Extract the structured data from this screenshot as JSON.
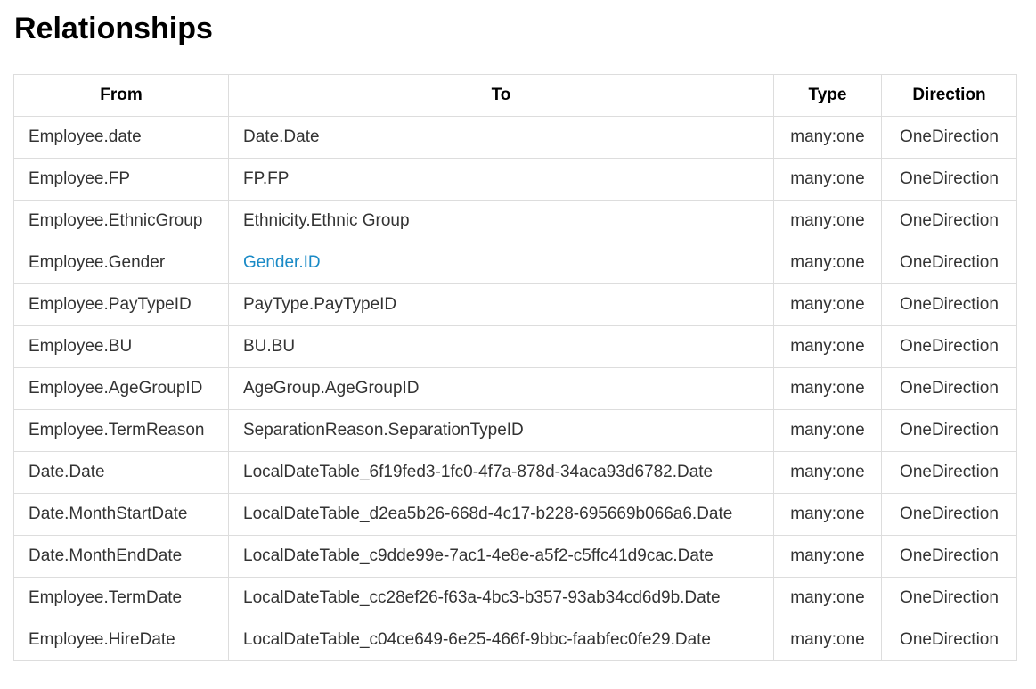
{
  "page": {
    "title": "Relationships"
  },
  "table": {
    "headers": [
      "From",
      "To",
      "Type",
      "Direction"
    ],
    "rows": [
      {
        "from": "Employee.date",
        "to": "Date.Date",
        "type": "many:one",
        "direction": "OneDirection",
        "to_is_link": false
      },
      {
        "from": "Employee.FP",
        "to": "FP.FP",
        "type": "many:one",
        "direction": "OneDirection",
        "to_is_link": false
      },
      {
        "from": "Employee.EthnicGroup",
        "to": "Ethnicity.Ethnic Group",
        "type": "many:one",
        "direction": "OneDirection",
        "to_is_link": false
      },
      {
        "from": "Employee.Gender",
        "to": "Gender.ID",
        "type": "many:one",
        "direction": "OneDirection",
        "to_is_link": true
      },
      {
        "from": "Employee.PayTypeID",
        "to": "PayType.PayTypeID",
        "type": "many:one",
        "direction": "OneDirection",
        "to_is_link": false
      },
      {
        "from": "Employee.BU",
        "to": "BU.BU",
        "type": "many:one",
        "direction": "OneDirection",
        "to_is_link": false
      },
      {
        "from": "Employee.AgeGroupID",
        "to": "AgeGroup.AgeGroupID",
        "type": "many:one",
        "direction": "OneDirection",
        "to_is_link": false
      },
      {
        "from": "Employee.TermReason",
        "to": "SeparationReason.SeparationTypeID",
        "type": "many:one",
        "direction": "OneDirection",
        "to_is_link": false
      },
      {
        "from": "Date.Date",
        "to": "LocalDateTable_6f19fed3-1fc0-4f7a-878d-34aca93d6782.Date",
        "type": "many:one",
        "direction": "OneDirection",
        "to_is_link": false
      },
      {
        "from": "Date.MonthStartDate",
        "to": "LocalDateTable_d2ea5b26-668d-4c17-b228-695669b066a6.Date",
        "type": "many:one",
        "direction": "OneDirection",
        "to_is_link": false
      },
      {
        "from": "Date.MonthEndDate",
        "to": "LocalDateTable_c9dde99e-7ac1-4e8e-a5f2-c5ffc41d9cac.Date",
        "type": "many:one",
        "direction": "OneDirection",
        "to_is_link": false
      },
      {
        "from": "Employee.TermDate",
        "to": "LocalDateTable_cc28ef26-f63a-4bc3-b357-93ab34cd6d9b.Date",
        "type": "many:one",
        "direction": "OneDirection",
        "to_is_link": false
      },
      {
        "from": "Employee.HireDate",
        "to": "LocalDateTable_c04ce649-6e25-466f-9bbc-faabfec0fe29.Date",
        "type": "many:one",
        "direction": "OneDirection",
        "to_is_link": false
      }
    ]
  },
  "colors": {
    "link": "#1a8ac6",
    "border": "#dddddd",
    "text": "#333333",
    "header_text": "#000000"
  }
}
